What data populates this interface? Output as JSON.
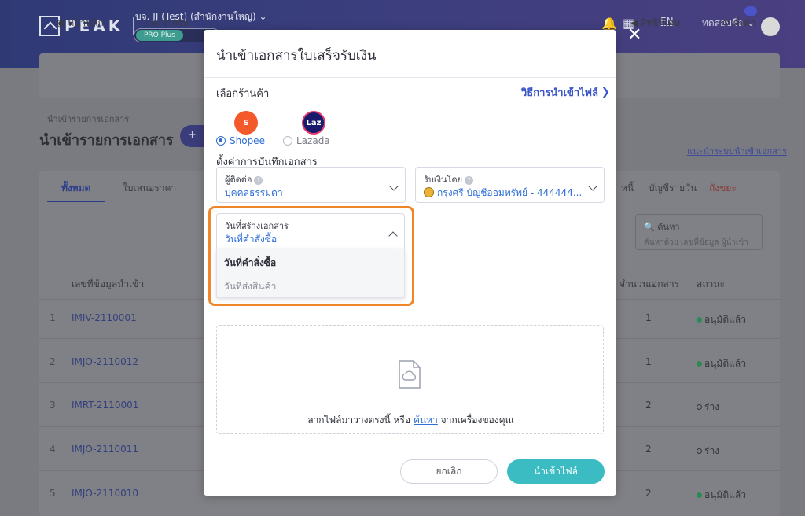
{
  "background": {
    "brand": "PEAK",
    "company": "บจ. JJ (Test) (สำนักงานใหญ่)",
    "plan": "PRO Plus",
    "language": "EN",
    "user_name": "ทดสอบชื่อ",
    "menu": {
      "home": "หน้าหลัก",
      "income": "รายรับ",
      "privileges": "สิทธิพิเศษ",
      "settings": "ตั้งค่า"
    },
    "breadcrumb": "นำเข้ารายการเอกสาร",
    "page_title": "นำเข้ารายการเอกสาร",
    "help_link": "แนะนำระบบนำเข้าเอกสาร",
    "tabs": {
      "all": "ทั้งหมด",
      "quotation": "ใบเสนอราคา",
      "debt": "หนี้",
      "daily": "บัญชีรายวัน",
      "trash": "ถังขยะ"
    },
    "search": {
      "label": "ค้นหา",
      "placeholder": "ค้นหาด้วย เลขที่ข้อมูล ผู้นำเข้า"
    },
    "table": {
      "headers": {
        "doc_no": "เลขที่ข้อมูลนำเข้า",
        "count": "จำนวนเอกสาร",
        "status": "สถานะ"
      },
      "rows": [
        {
          "idx": "1",
          "doc": "IMIV-2110001",
          "count": "1",
          "status": "อนุมัติแล้ว"
        },
        {
          "idx": "2",
          "doc": "IMJO-2110012",
          "count": "1",
          "status": "อนุมัติแล้ว"
        },
        {
          "idx": "3",
          "doc": "IMRT-2110001",
          "count": "2",
          "status": "ร่าง"
        },
        {
          "idx": "4",
          "doc": "IMJO-2110011",
          "count": "2",
          "status": "ร่าง"
        },
        {
          "idx": "5",
          "doc": "IMJO-2110010",
          "count": "2",
          "status": "อนุมัติแล้ว"
        }
      ]
    }
  },
  "modal": {
    "title": "นำเข้าเอกสารใบเสร็จรับเงิน",
    "store_label": "เลือกร้านค้า",
    "how_to_link": "วิธีการนำเข้าไฟล์",
    "stores": [
      {
        "name": "Shopee",
        "logo_text": "S",
        "selected": true
      },
      {
        "name": "Lazada",
        "logo_text": "Laz",
        "selected": false
      }
    ],
    "settings_label": "ตั้งค่าการบันทึกเอกสาร",
    "contact": {
      "label": "ผู้ติดต่อ",
      "value": "บุคคลธรรมดา"
    },
    "receive": {
      "label": "รับเงินโดย",
      "value": "กรุงศรี บัญชีออมทรัพย์ - 444444..."
    },
    "doc_date": {
      "label": "วันที่สร้างเอกสาร",
      "value": "วันที่คำสั่งซื้อ",
      "options": [
        "วันที่คำสั่งซื้อ",
        "วันที่ส่งสินค้า"
      ]
    },
    "upload": {
      "text_before": "ลากไฟล์มาวางตรงนี้ หรือ",
      "link": "ค้นหา",
      "text_after": "จากเครื่องของคุณ"
    },
    "buttons": {
      "cancel": "ยกเลิก",
      "import": "นำเข้าไฟล์"
    }
  },
  "colors": {
    "accent": "#2f6fd6",
    "highlight": "#f0862a",
    "import_button": "#3bbcc3",
    "approved": "#2d8a55"
  }
}
